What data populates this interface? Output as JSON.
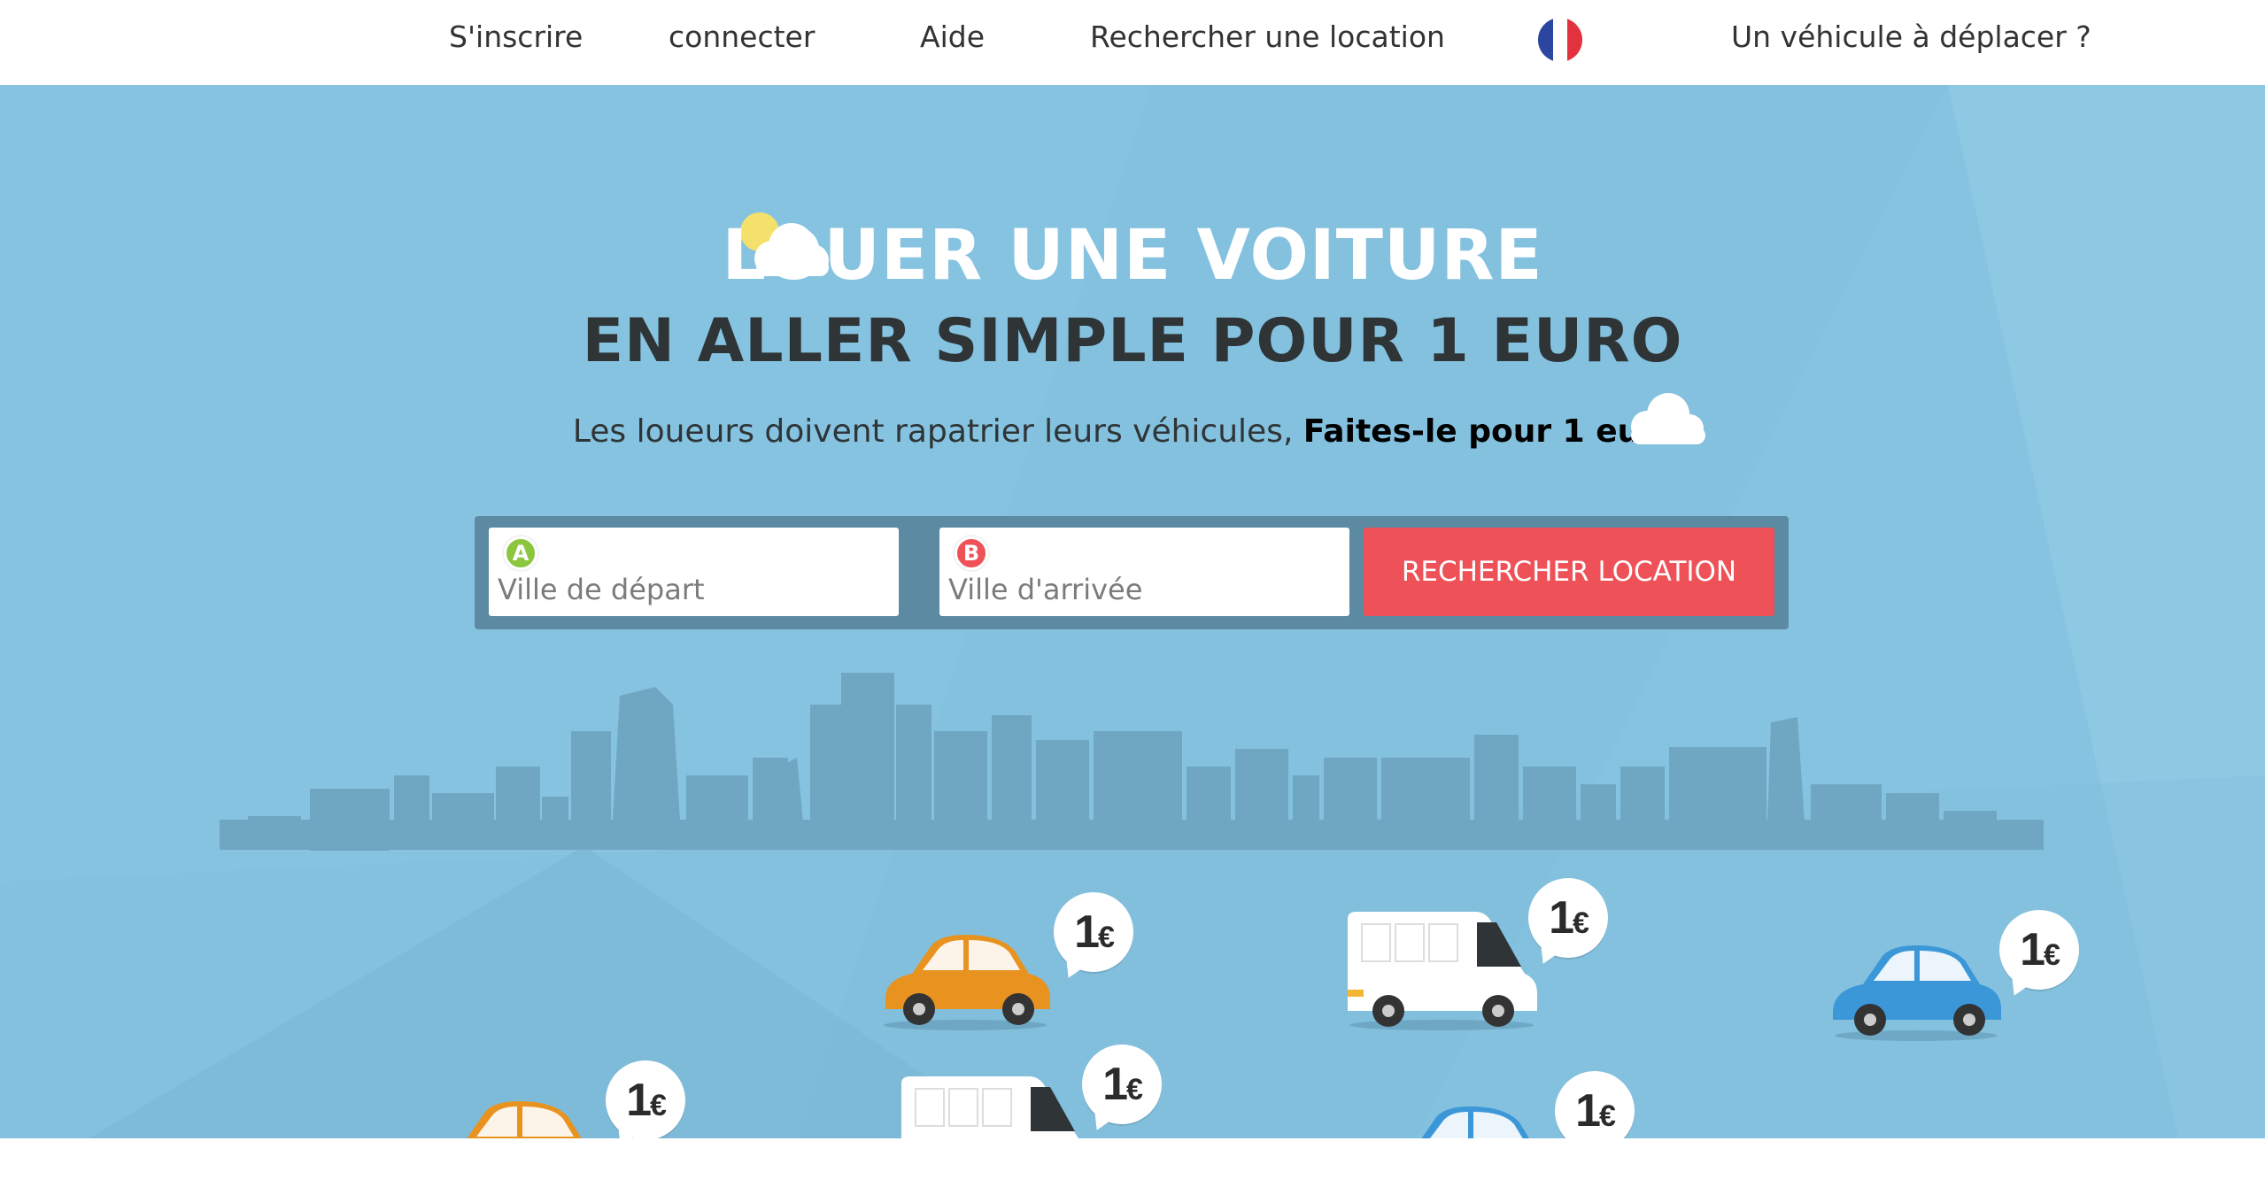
{
  "nav": {
    "signup": "S'inscrire",
    "login": "connecter",
    "help": "Aide",
    "search_rental": "Rechercher une location",
    "language": "fr-flag-icon",
    "vehicle_to_move": "Un véhicule à déplacer ?"
  },
  "hero": {
    "title_line1": "LOUER UNE VOITURE",
    "title_line2": "EN ALLER SIMPLE POUR 1 EURO",
    "subtitle_regular": "Les loueurs doivent rapatrier leurs véhicules, ",
    "subtitle_bold": "Faites-le pour 1 euro!"
  },
  "search": {
    "departure_marker": "A",
    "departure_placeholder": "Ville de départ",
    "arrival_marker": "B",
    "arrival_placeholder": "Ville d'arrivée",
    "submit_label": "RECHERCHER LOCATION"
  },
  "vehicles": [
    {
      "type": "car",
      "color": "orange",
      "price": "1",
      "currency": "€"
    },
    {
      "type": "van",
      "color": "white",
      "price": "1",
      "currency": "€"
    },
    {
      "type": "car",
      "color": "blue",
      "price": "1",
      "currency": "€"
    },
    {
      "type": "car",
      "color": "orange",
      "price": "1",
      "currency": "€"
    },
    {
      "type": "van",
      "color": "white",
      "price": "1",
      "currency": "€"
    },
    {
      "type": "car",
      "color": "blue",
      "price": "1",
      "currency": "€"
    }
  ],
  "colors": {
    "hero_bg": "#86c3e1",
    "skyline": "#6fa6c2",
    "search_box": "#5d8aa3",
    "button": "#ee5157",
    "marker_a": "#8cc63e",
    "marker_b": "#ee5157",
    "car_orange": "#e8921f",
    "car_blue": "#3c97d8"
  }
}
